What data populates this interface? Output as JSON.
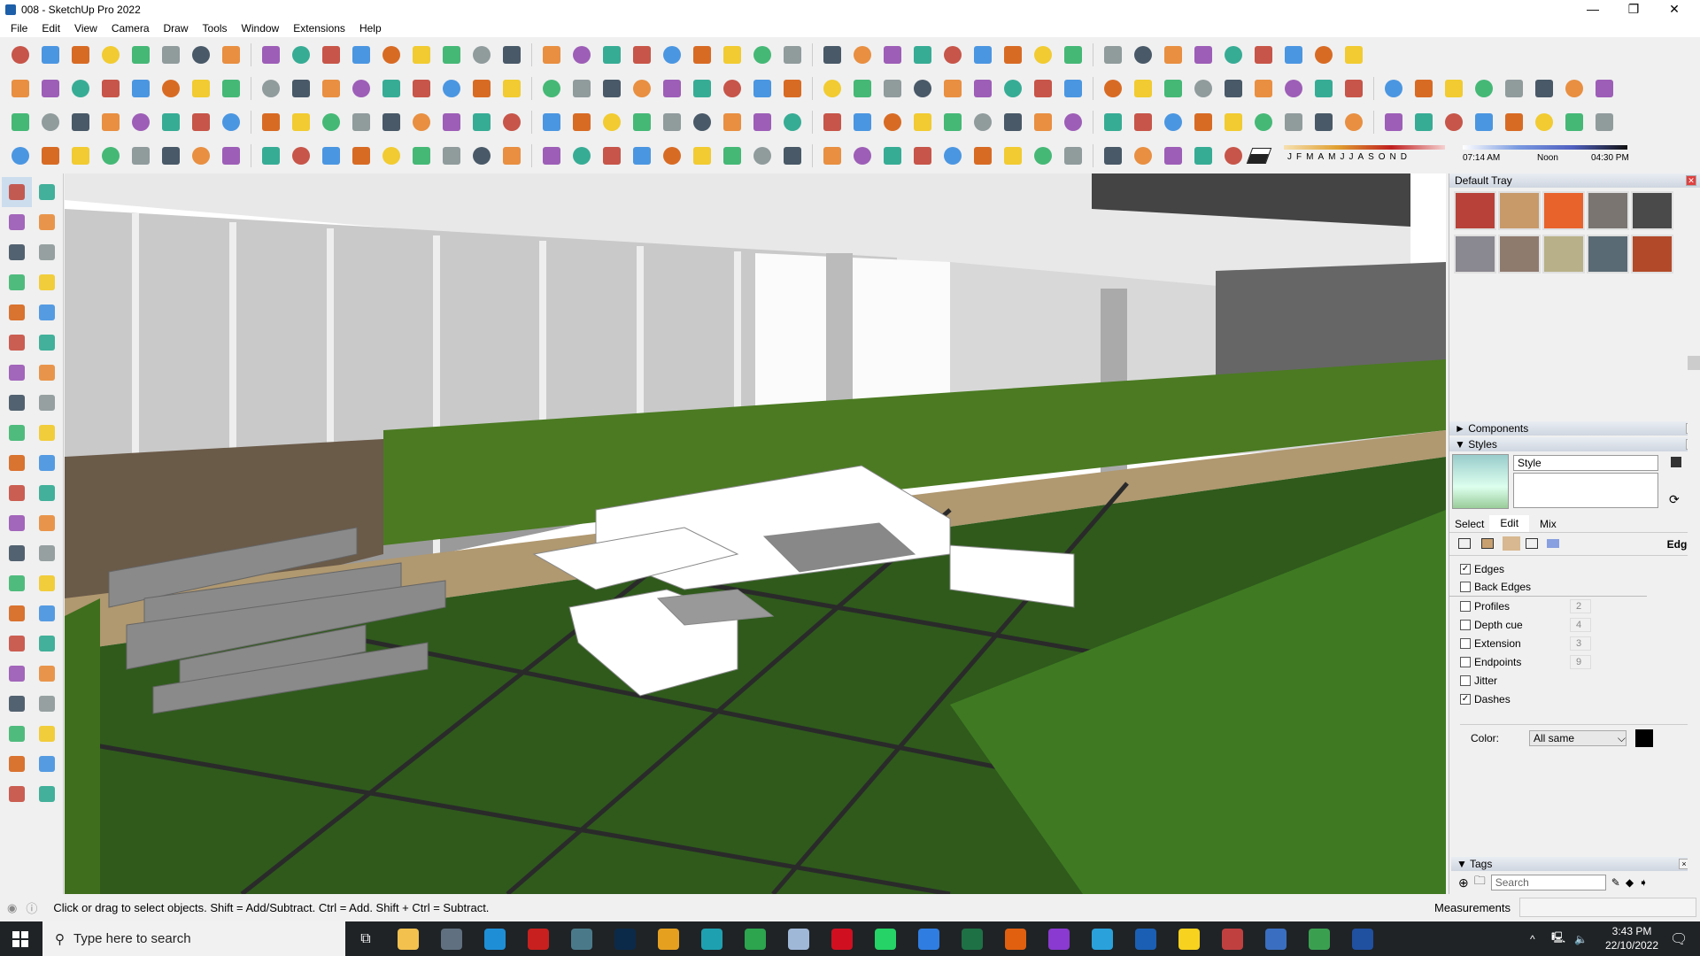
{
  "window": {
    "title": "008 - SketchUp Pro 2022",
    "minimize": "—",
    "maximize": "❐",
    "close": "✕"
  },
  "menu": [
    "File",
    "Edit",
    "View",
    "Camera",
    "Draw",
    "Tools",
    "Window",
    "Extensions",
    "Help"
  ],
  "toolbar_colors": [
    "#c0392b",
    "#e67e22",
    "#27ae60",
    "#2e86de",
    "#8e44ad",
    "#7f8c8d",
    "#d35400",
    "#16a085",
    "#2c3e50",
    "#f1c40f"
  ],
  "toolbar_rows": [
    44,
    52,
    52,
    40
  ],
  "shadow": {
    "months": [
      "J",
      "F",
      "M",
      "A",
      "M",
      "J",
      "J",
      "A",
      "S",
      "O",
      "N",
      "D"
    ],
    "time_start": "07:14 AM",
    "time_mid": "Noon",
    "time_end": "04:30 PM",
    "date_fraction": 0.95,
    "time_fraction": 0.73
  },
  "left_tools": [
    "select",
    "orbit",
    "paint-bucket",
    "eraser",
    "component",
    "tape",
    "line",
    "freehand",
    "rectangle",
    "rotated-rect",
    "circle",
    "polygon",
    "arc",
    "pie",
    "arc3",
    "arc2",
    "move",
    "push-pull",
    "rotate",
    "follow-me",
    "scale",
    "offset",
    "tape-measure",
    "dimension",
    "protractor",
    "text",
    "axes",
    "3d-text",
    "orbit2",
    "pan",
    "zoom",
    "zoom-window",
    "zoom-extents",
    "previous",
    "position-camera",
    "look-around",
    "walk",
    "section-plane",
    "sandbox1",
    "sandbox2",
    "sandbox3",
    "sandbox4"
  ],
  "tray": {
    "title": "Default Tray",
    "materials": [
      "#b8423a",
      "#c89a6a",
      "#e8622c",
      "#7a7570",
      "#4a4a4a",
      "#8a8890",
      "#8f7a6e",
      "#b8b088",
      "#5a6a74",
      "#b24a2a"
    ],
    "components": "Components",
    "styles": "Styles",
    "style_name": "Style",
    "tabs": [
      "Select",
      "Edit",
      "Mix"
    ],
    "section": "Edge",
    "edge_settings": [
      {
        "label": "Edges",
        "checked": true
      },
      {
        "label": "Back Edges",
        "checked": false
      },
      {
        "label": "Profiles",
        "checked": false,
        "value": "2"
      },
      {
        "label": "Depth cue",
        "checked": false,
        "value": "4"
      },
      {
        "label": "Extension",
        "checked": false,
        "value": "3"
      },
      {
        "label": "Endpoints",
        "checked": false,
        "value": "9"
      },
      {
        "label": "Jitter",
        "checked": false
      },
      {
        "label": "Dashes",
        "checked": true
      }
    ],
    "color_label": "Color:",
    "color_value": "All same",
    "tags": "Tags",
    "tags_search": "Search"
  },
  "status": {
    "hint": "Click or drag to select objects. Shift = Add/Subtract. Ctrl = Add. Shift + Ctrl = Subtract.",
    "measurements": "Measurements"
  },
  "taskbar": {
    "search": "Type here to search",
    "time": "3:43 PM",
    "date": "22/10/2022",
    "apps": [
      [
        "file-explorer",
        "#f2c14e"
      ],
      [
        "calculator",
        "#607080"
      ],
      [
        "edge",
        "#1e8fd6"
      ],
      [
        "autocad",
        "#c8201e"
      ],
      [
        "app-11",
        "#4a7a8a"
      ],
      [
        "photoshop",
        "#0b2a4a"
      ],
      [
        "chrome-profile",
        "#e6a020"
      ],
      [
        "3dsmax",
        "#1ea0b0"
      ],
      [
        "chrome",
        "#2da44e"
      ],
      [
        "notes",
        "#a0b8d8"
      ],
      [
        "opera",
        "#d01020"
      ],
      [
        "whatsapp",
        "#25d366"
      ],
      [
        "todo",
        "#2f7de1"
      ],
      [
        "excel",
        "#1e7145"
      ],
      [
        "app-g",
        "#e06010"
      ],
      [
        "podcast",
        "#8a3ad0"
      ],
      [
        "telegram",
        "#2aa1da"
      ],
      [
        "shield",
        "#1a5fb4"
      ],
      [
        "sticky-notes",
        "#f7d21e"
      ],
      [
        "app-grid",
        "#c04040"
      ],
      [
        "sketchup-tray",
        "#3a6ec0"
      ],
      [
        "chrome-alt",
        "#3aa050"
      ],
      [
        "sketchup",
        "#2050a0"
      ]
    ]
  }
}
